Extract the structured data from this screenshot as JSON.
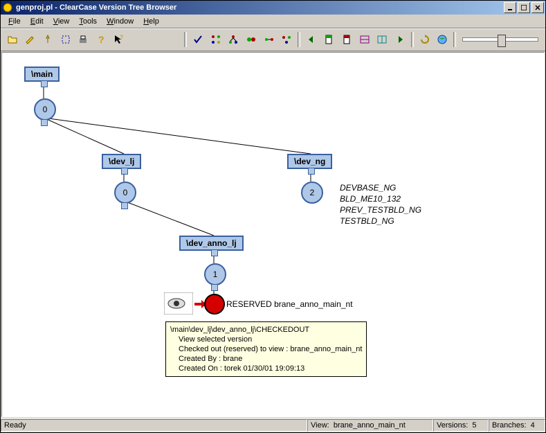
{
  "window": {
    "title": "genproj.pl - ClearCase Version Tree Browser"
  },
  "menu": {
    "file": "File",
    "edit": "Edit",
    "view": "View",
    "tools": "Tools",
    "window": "Window",
    "help": "Help"
  },
  "tree": {
    "main": "\\main",
    "main_v0": "0",
    "dev_lj": "\\dev_lj",
    "dev_lj_v0": "0",
    "dev_ng": "\\dev_ng",
    "dev_ng_v2": "2",
    "dev_anno_lj": "\\dev_anno_lj",
    "dev_anno_lj_v1": "1",
    "reserved": "RESERVED brane_anno_main_nt",
    "labels": {
      "l1": "DEVBASE_NG",
      "l2": "BLD_ME10_132",
      "l3": "PREV_TESTBLD_NG",
      "l4": "TESTBLD_NG"
    }
  },
  "tooltip": {
    "line1": "\\main\\dev_lj\\dev_anno_lj\\CHECKEDOUT",
    "line2": "View selected version",
    "line3": "Checked out (reserved) to view : brane_anno_main_nt",
    "line4": "Created By : brane",
    "line5": "Created On : torek 01/30/01 19:09:13"
  },
  "status": {
    "ready": "Ready",
    "view_label": "View:",
    "view_value": "brane_anno_main_nt",
    "versions_label": "Versions:",
    "versions_value": "5",
    "branches_label": "Branches:",
    "branches_value": "4"
  }
}
